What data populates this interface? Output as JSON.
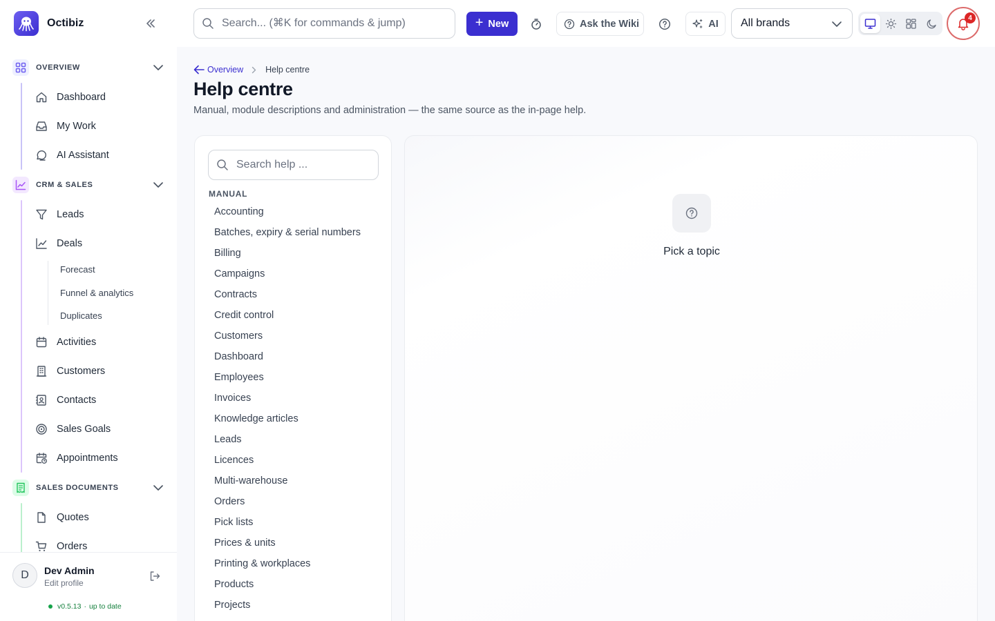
{
  "app": {
    "name": "Octibiz",
    "colors": {
      "accent": "#3b2fd0",
      "danger": "#dc2626",
      "success": "#16a34a"
    }
  },
  "sidebar": {
    "groups": [
      {
        "label": "OVERVIEW",
        "icon": "grid-icon",
        "color": "#6d5ef0",
        "items": [
          {
            "label": "Dashboard",
            "icon": "home-icon"
          },
          {
            "label": "My Work",
            "icon": "inbox-icon"
          },
          {
            "label": "AI Assistant",
            "icon": "chat-icon"
          }
        ]
      },
      {
        "label": "CRM & SALES",
        "icon": "chart-line-icon",
        "color": "#a855f7",
        "items": [
          {
            "label": "Leads",
            "icon": "funnel-icon"
          },
          {
            "label": "Deals",
            "icon": "trend-icon",
            "sub": [
              "Forecast",
              "Funnel & analytics",
              "Duplicates"
            ]
          },
          {
            "label": "Activities",
            "icon": "calendar-icon"
          },
          {
            "label": "Customers",
            "icon": "building-icon"
          },
          {
            "label": "Contacts",
            "icon": "contact-card-icon"
          },
          {
            "label": "Sales Goals",
            "icon": "target-icon"
          },
          {
            "label": "Appointments",
            "icon": "calendar-clock-icon"
          }
        ]
      },
      {
        "label": "SALES DOCUMENTS",
        "icon": "receipt-icon",
        "color": "#22c55e",
        "items": [
          {
            "label": "Quotes",
            "icon": "file-icon"
          },
          {
            "label": "Orders",
            "icon": "cart-icon"
          }
        ]
      }
    ]
  },
  "user": {
    "initial": "D",
    "name": "Dev Admin",
    "edit_label": "Edit profile",
    "version": "v0.5.13",
    "version_status": "up to date"
  },
  "topbar": {
    "search_placeholder": "Search... (⌘K for commands & jump)",
    "new_label": "New",
    "wiki_label": "Ask the Wiki",
    "ai_label": "AI",
    "brand_selected": "All brands",
    "theme_options": [
      "monitor-icon",
      "sun-icon",
      "layout-icon",
      "moon-icon"
    ],
    "theme_active": "monitor-icon",
    "notification_count": "4"
  },
  "main": {
    "breadcrumb": {
      "back_label": "Overview",
      "current": "Help centre"
    },
    "title": "Help centre",
    "subtitle": "Manual, module descriptions and administration — the same source as the in-page help.",
    "help_search_placeholder": "Search help ...",
    "section_label": "MANUAL",
    "topics": [
      "Accounting",
      "Batches, expiry & serial numbers",
      "Billing",
      "Campaigns",
      "Contracts",
      "Credit control",
      "Customers",
      "Dashboard",
      "Employees",
      "Invoices",
      "Knowledge articles",
      "Leads",
      "Licences",
      "Multi-warehouse",
      "Orders",
      "Pick lists",
      "Prices & units",
      "Printing & workplaces",
      "Products",
      "Projects"
    ],
    "empty_state": "Pick a topic"
  }
}
